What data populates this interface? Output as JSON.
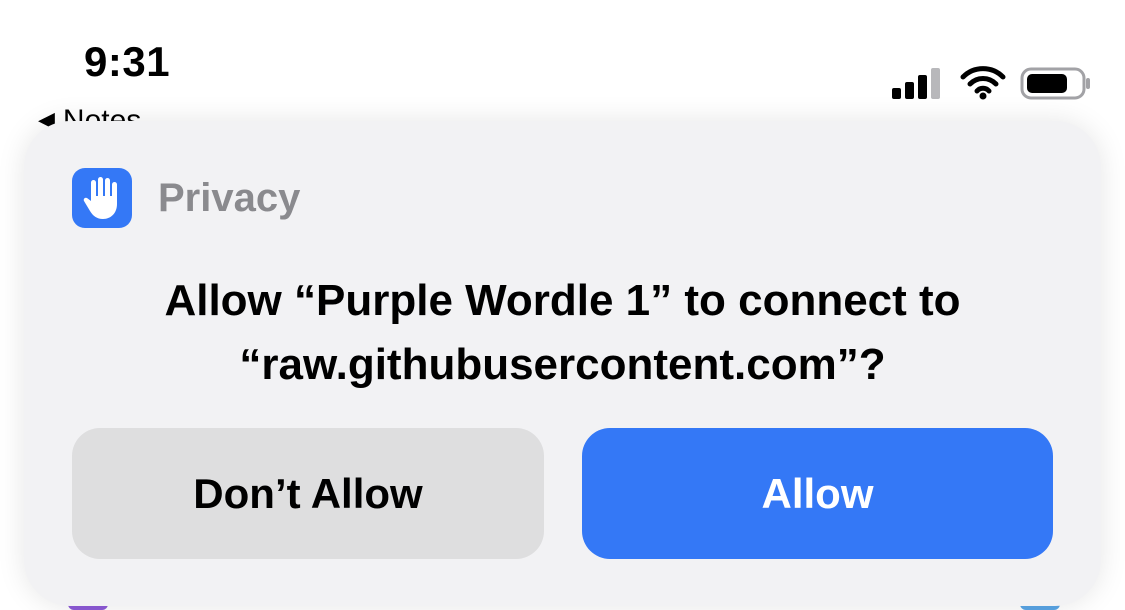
{
  "status_bar": {
    "time": "9:31",
    "icons": [
      "signal-bars-icon",
      "wifi-icon",
      "battery-icon"
    ]
  },
  "back_link": {
    "label": "Notes",
    "icon": "back-triangle-icon"
  },
  "banner": {
    "app_icon": "raised-hand-icon",
    "app_name": "Privacy",
    "message": "Allow “Purple Wordle 1” to connect to “raw.githubusercontent.com”?",
    "buttons": {
      "deny_label": "Don’t Allow",
      "allow_label": "Allow"
    }
  },
  "colors": {
    "accent_blue": "#3478f6",
    "banner_bg": "#f2f2f4",
    "deny_bg": "#dededf",
    "app_name_gray": "#8a8a8e"
  }
}
